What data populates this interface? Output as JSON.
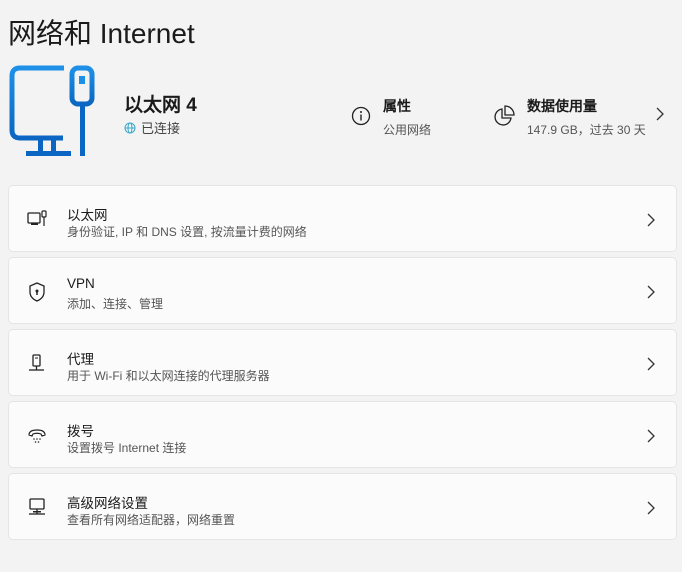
{
  "title": "网络和 Internet",
  "connection": {
    "name": "以太网 4",
    "status": "已连接"
  },
  "properties": {
    "title": "属性",
    "subtitle": "公用网络"
  },
  "data_usage": {
    "title": "数据使用量",
    "subtitle": "147.9 GB，过去 30 天"
  },
  "accent": "#0f7ad8",
  "items": [
    {
      "label": "以太网",
      "sub": "身份验证, IP 和 DNS 设置, 按流量计费的网络",
      "icon": "ethernet-icon"
    },
    {
      "label": "VPN",
      "sub": "添加、连接、管理",
      "icon": "shield-icon"
    },
    {
      "label": "代理",
      "sub": "用于 Wi-Fi 和以太网连接的代理服务器",
      "icon": "proxy-icon"
    },
    {
      "label": "拨号",
      "sub": "设置拨号 Internet 连接",
      "icon": "dialup-icon"
    },
    {
      "label": "高级网络设置",
      "sub": "查看所有网络适配器，网络重置",
      "icon": "network-adapter-icon"
    }
  ]
}
